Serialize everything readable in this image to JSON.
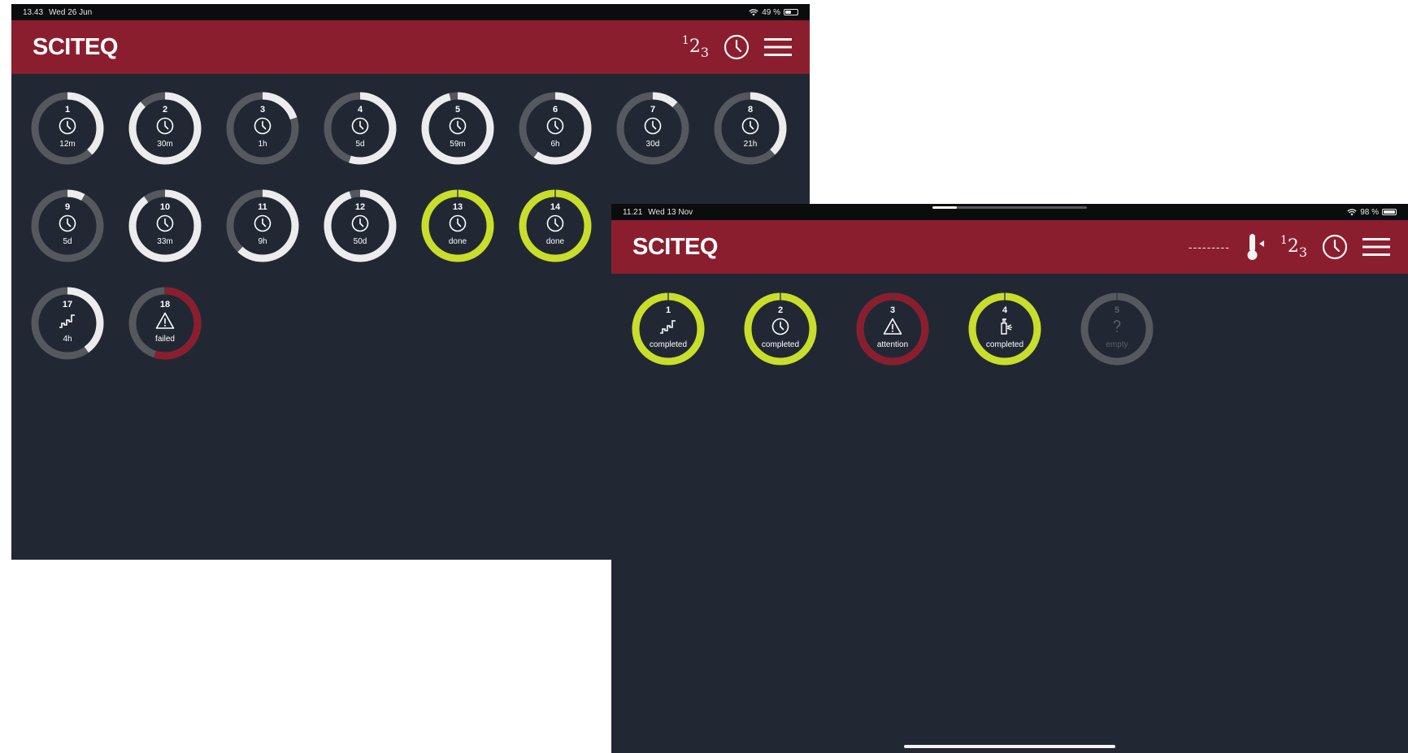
{
  "screen1": {
    "status": {
      "time": "13.43",
      "date": "Wed 26 Jun",
      "battery": "49 %",
      "battery_level": 0.49
    },
    "brand": "SCITEQ",
    "tiles": [
      {
        "num": "1",
        "label": "12m",
        "icon": "clock-icon",
        "progress": 0.38,
        "state": "running"
      },
      {
        "num": "2",
        "label": "30m",
        "icon": "clock-icon",
        "progress": 0.88,
        "state": "running"
      },
      {
        "num": "3",
        "label": "1h",
        "icon": "clock-icon",
        "progress": 0.2,
        "state": "running"
      },
      {
        "num": "4",
        "label": "5d",
        "icon": "clock-icon",
        "progress": 0.55,
        "state": "running"
      },
      {
        "num": "5",
        "label": "59m",
        "icon": "clock-icon",
        "progress": 0.96,
        "state": "running"
      },
      {
        "num": "6",
        "label": "6h",
        "icon": "clock-icon",
        "progress": 0.6,
        "state": "running"
      },
      {
        "num": "7",
        "label": "30d",
        "icon": "clock-icon",
        "progress": 0.12,
        "state": "running"
      },
      {
        "num": "8",
        "label": "21h",
        "icon": "clock-icon",
        "progress": 0.38,
        "state": "running"
      },
      {
        "num": "9",
        "label": "5d",
        "icon": "clock-icon",
        "progress": 0.08,
        "state": "running"
      },
      {
        "num": "10",
        "label": "33m",
        "icon": "clock-icon",
        "progress": 0.9,
        "state": "running"
      },
      {
        "num": "11",
        "label": "9h",
        "icon": "clock-icon",
        "progress": 0.62,
        "state": "running"
      },
      {
        "num": "12",
        "label": "50d",
        "icon": "clock-icon",
        "progress": 0.95,
        "state": "running"
      },
      {
        "num": "13",
        "label": "done",
        "icon": "clock-icon",
        "progress": 1,
        "state": "done"
      },
      {
        "num": "14",
        "label": "done",
        "icon": "clock-icon",
        "progress": 1,
        "state": "done"
      },
      {
        "num": "17",
        "label": "4h",
        "icon": "ramp-icon",
        "progress": 0.4,
        "state": "running"
      },
      {
        "num": "18",
        "label": "failed",
        "icon": "warning-icon",
        "progress": 0.55,
        "state": "failed"
      }
    ]
  },
  "screen2": {
    "status": {
      "time": "11.21",
      "date": "Wed 13 Nov",
      "battery": "98 %",
      "battery_level": 0.98
    },
    "brand": "SCITEQ",
    "temperature": "---------",
    "tiles": [
      {
        "num": "1",
        "label": "completed",
        "icon": "ramp-icon",
        "progress": 1,
        "state": "done"
      },
      {
        "num": "2",
        "label": "completed",
        "icon": "clock-icon",
        "progress": 1,
        "state": "done"
      },
      {
        "num": "3",
        "label": "attention",
        "icon": "warning-icon",
        "progress": 1,
        "state": "failed"
      },
      {
        "num": "4",
        "label": "completed",
        "icon": "valve-icon",
        "progress": 1,
        "state": "done"
      },
      {
        "num": "5",
        "label": "empty",
        "icon": "question-icon",
        "progress": 0,
        "state": "empty"
      }
    ]
  },
  "colors": {
    "brand": "#8b1e2e",
    "background": "#212833",
    "track": "#55585d",
    "progress": "#ececec",
    "done": "#c9de2a",
    "failed": "#8b1e2e"
  }
}
